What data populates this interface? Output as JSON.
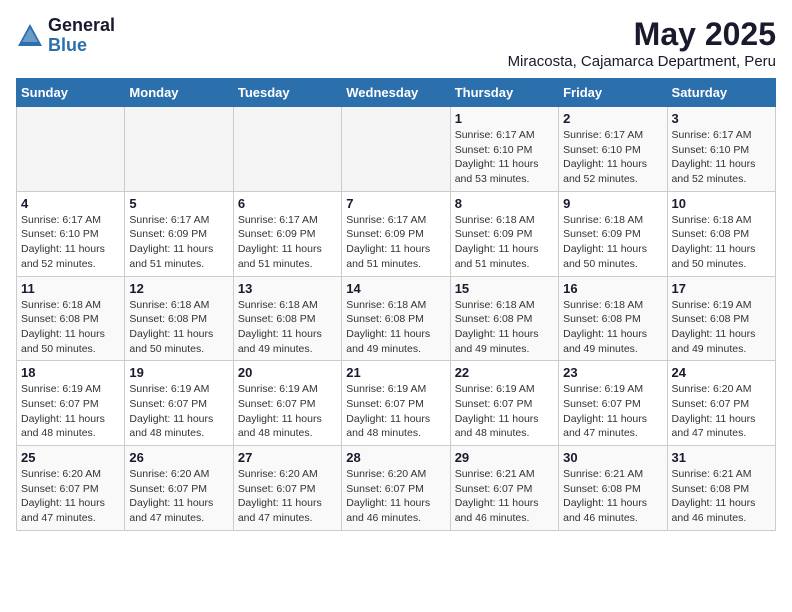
{
  "logo": {
    "general": "General",
    "blue": "Blue"
  },
  "header": {
    "month": "May 2025",
    "location": "Miracosta, Cajamarca Department, Peru"
  },
  "weekdays": [
    "Sunday",
    "Monday",
    "Tuesday",
    "Wednesday",
    "Thursday",
    "Friday",
    "Saturday"
  ],
  "weeks": [
    [
      {
        "day": "",
        "info": ""
      },
      {
        "day": "",
        "info": ""
      },
      {
        "day": "",
        "info": ""
      },
      {
        "day": "",
        "info": ""
      },
      {
        "day": "1",
        "info": "Sunrise: 6:17 AM\nSunset: 6:10 PM\nDaylight: 11 hours\nand 53 minutes."
      },
      {
        "day": "2",
        "info": "Sunrise: 6:17 AM\nSunset: 6:10 PM\nDaylight: 11 hours\nand 52 minutes."
      },
      {
        "day": "3",
        "info": "Sunrise: 6:17 AM\nSunset: 6:10 PM\nDaylight: 11 hours\nand 52 minutes."
      }
    ],
    [
      {
        "day": "4",
        "info": "Sunrise: 6:17 AM\nSunset: 6:10 PM\nDaylight: 11 hours\nand 52 minutes."
      },
      {
        "day": "5",
        "info": "Sunrise: 6:17 AM\nSunset: 6:09 PM\nDaylight: 11 hours\nand 51 minutes."
      },
      {
        "day": "6",
        "info": "Sunrise: 6:17 AM\nSunset: 6:09 PM\nDaylight: 11 hours\nand 51 minutes."
      },
      {
        "day": "7",
        "info": "Sunrise: 6:17 AM\nSunset: 6:09 PM\nDaylight: 11 hours\nand 51 minutes."
      },
      {
        "day": "8",
        "info": "Sunrise: 6:18 AM\nSunset: 6:09 PM\nDaylight: 11 hours\nand 51 minutes."
      },
      {
        "day": "9",
        "info": "Sunrise: 6:18 AM\nSunset: 6:09 PM\nDaylight: 11 hours\nand 50 minutes."
      },
      {
        "day": "10",
        "info": "Sunrise: 6:18 AM\nSunset: 6:08 PM\nDaylight: 11 hours\nand 50 minutes."
      }
    ],
    [
      {
        "day": "11",
        "info": "Sunrise: 6:18 AM\nSunset: 6:08 PM\nDaylight: 11 hours\nand 50 minutes."
      },
      {
        "day": "12",
        "info": "Sunrise: 6:18 AM\nSunset: 6:08 PM\nDaylight: 11 hours\nand 50 minutes."
      },
      {
        "day": "13",
        "info": "Sunrise: 6:18 AM\nSunset: 6:08 PM\nDaylight: 11 hours\nand 49 minutes."
      },
      {
        "day": "14",
        "info": "Sunrise: 6:18 AM\nSunset: 6:08 PM\nDaylight: 11 hours\nand 49 minutes."
      },
      {
        "day": "15",
        "info": "Sunrise: 6:18 AM\nSunset: 6:08 PM\nDaylight: 11 hours\nand 49 minutes."
      },
      {
        "day": "16",
        "info": "Sunrise: 6:18 AM\nSunset: 6:08 PM\nDaylight: 11 hours\nand 49 minutes."
      },
      {
        "day": "17",
        "info": "Sunrise: 6:19 AM\nSunset: 6:08 PM\nDaylight: 11 hours\nand 49 minutes."
      }
    ],
    [
      {
        "day": "18",
        "info": "Sunrise: 6:19 AM\nSunset: 6:07 PM\nDaylight: 11 hours\nand 48 minutes."
      },
      {
        "day": "19",
        "info": "Sunrise: 6:19 AM\nSunset: 6:07 PM\nDaylight: 11 hours\nand 48 minutes."
      },
      {
        "day": "20",
        "info": "Sunrise: 6:19 AM\nSunset: 6:07 PM\nDaylight: 11 hours\nand 48 minutes."
      },
      {
        "day": "21",
        "info": "Sunrise: 6:19 AM\nSunset: 6:07 PM\nDaylight: 11 hours\nand 48 minutes."
      },
      {
        "day": "22",
        "info": "Sunrise: 6:19 AM\nSunset: 6:07 PM\nDaylight: 11 hours\nand 48 minutes."
      },
      {
        "day": "23",
        "info": "Sunrise: 6:19 AM\nSunset: 6:07 PM\nDaylight: 11 hours\nand 47 minutes."
      },
      {
        "day": "24",
        "info": "Sunrise: 6:20 AM\nSunset: 6:07 PM\nDaylight: 11 hours\nand 47 minutes."
      }
    ],
    [
      {
        "day": "25",
        "info": "Sunrise: 6:20 AM\nSunset: 6:07 PM\nDaylight: 11 hours\nand 47 minutes."
      },
      {
        "day": "26",
        "info": "Sunrise: 6:20 AM\nSunset: 6:07 PM\nDaylight: 11 hours\nand 47 minutes."
      },
      {
        "day": "27",
        "info": "Sunrise: 6:20 AM\nSunset: 6:07 PM\nDaylight: 11 hours\nand 47 minutes."
      },
      {
        "day": "28",
        "info": "Sunrise: 6:20 AM\nSunset: 6:07 PM\nDaylight: 11 hours\nand 46 minutes."
      },
      {
        "day": "29",
        "info": "Sunrise: 6:21 AM\nSunset: 6:07 PM\nDaylight: 11 hours\nand 46 minutes."
      },
      {
        "day": "30",
        "info": "Sunrise: 6:21 AM\nSunset: 6:08 PM\nDaylight: 11 hours\nand 46 minutes."
      },
      {
        "day": "31",
        "info": "Sunrise: 6:21 AM\nSunset: 6:08 PM\nDaylight: 11 hours\nand 46 minutes."
      }
    ]
  ]
}
